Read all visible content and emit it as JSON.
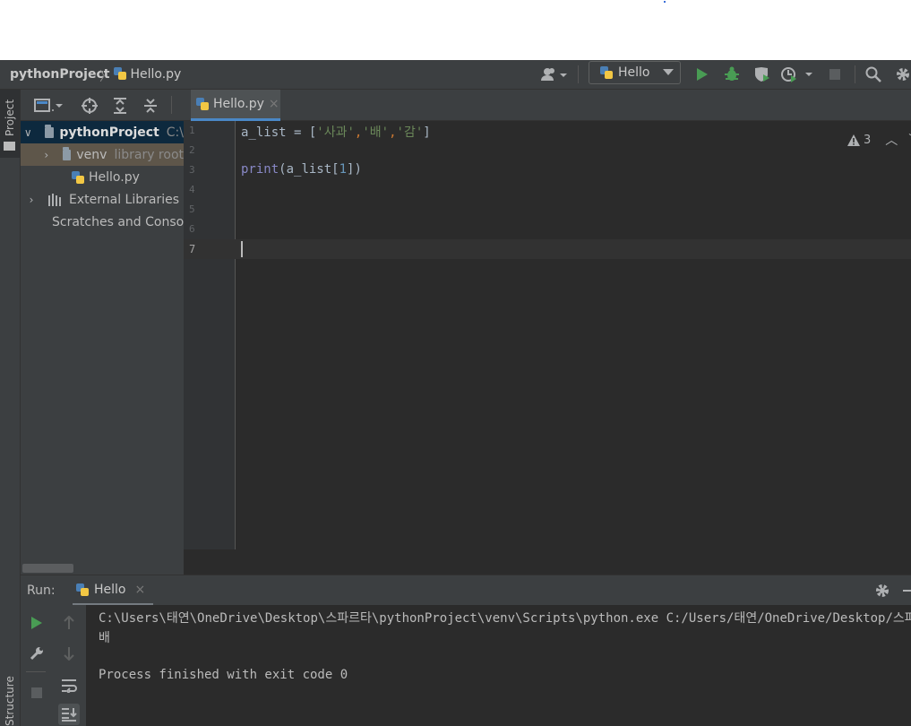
{
  "navbar": {
    "project": "pythonProject",
    "file": "Hello.py",
    "run_config": "Hello"
  },
  "left_strip": {
    "project_tab": "Project",
    "structure_tab": "Structure"
  },
  "project_tree": {
    "root_name": "pythonProject",
    "root_path": "C:\\",
    "venv_label": "venv",
    "venv_hint": "library root",
    "file": "Hello.py",
    "ext_libs": "External Libraries",
    "scratches": "Scratches and Consoles"
  },
  "editor": {
    "tab_label": "Hello.py",
    "line_numbers": [
      "1",
      "2",
      "3",
      "4",
      "5",
      "6",
      "7"
    ],
    "warnings_count": "3",
    "code": {
      "l1_var": "a_list = [",
      "l1_s1": "'사과'",
      "l1_sep1": ",",
      "l1_s2": "'배'",
      "l1_sep2": ",",
      "l1_s3": "'감'",
      "l1_end": "]",
      "l3_fn": "print",
      "l3_mid": "(a_list[",
      "l3_num": "1",
      "l3_end": "])"
    }
  },
  "run": {
    "label": "Run:",
    "tab": "Hello",
    "output": [
      "C:\\Users\\태연\\OneDrive\\Desktop\\스파르타\\pythonProject\\venv\\Scripts\\python.exe C:/Users/태연/OneDrive/Desktop/스파르타/",
      "배",
      "",
      "Process finished with exit code 0"
    ]
  },
  "colors": {
    "accent": "#4a88c7",
    "run_green": "#499c54",
    "string": "#6a8759",
    "builtin": "#8888c6",
    "number": "#6897bb"
  }
}
